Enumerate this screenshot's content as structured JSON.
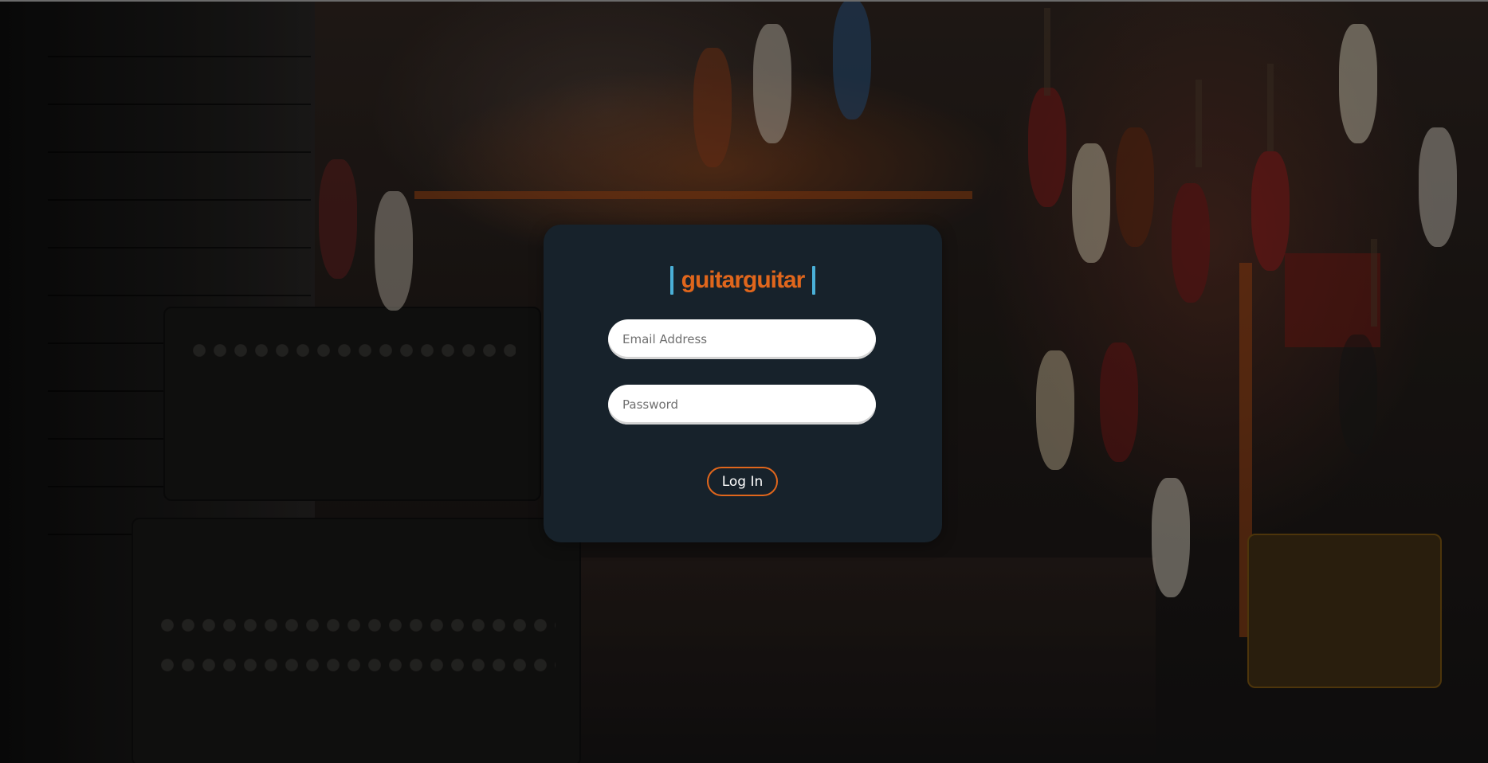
{
  "brand": {
    "name": "guitarguitar",
    "accent_color": "#e0661c",
    "bar_color": "#4ab0d8"
  },
  "login": {
    "email_placeholder": "Email Address",
    "password_placeholder": "Password",
    "submit_label": "Log In"
  },
  "background": {
    "description_icon": "guitar-store-photo"
  },
  "colors": {
    "card_bg": "#17222b",
    "button_border": "#e0661c"
  }
}
